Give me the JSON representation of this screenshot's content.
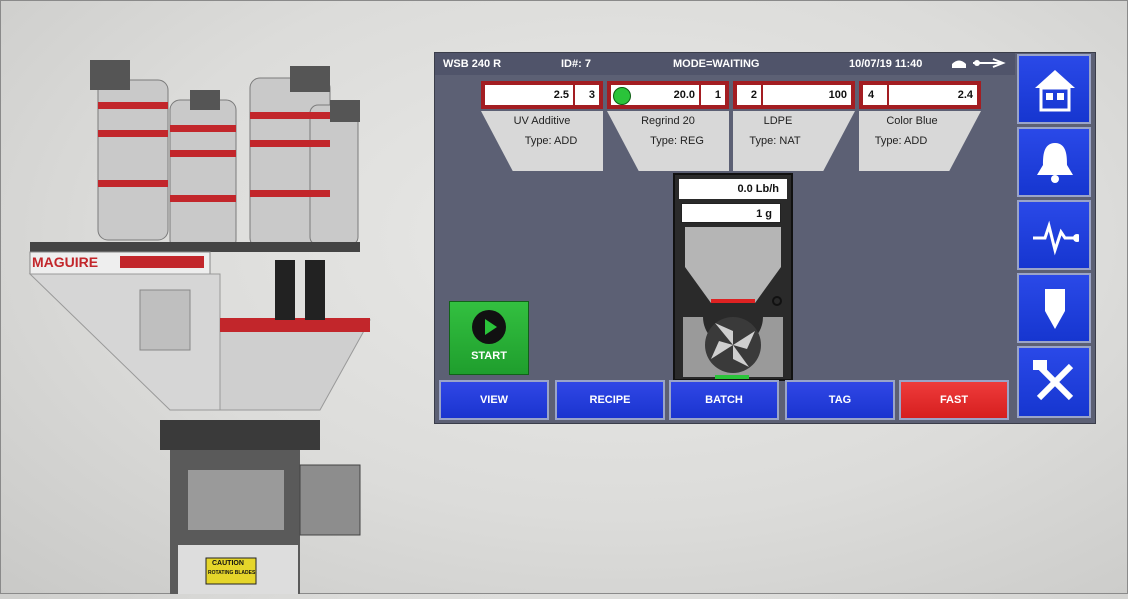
{
  "machine": {
    "brand_label": "MAGUIRE",
    "caution_label": "CAUTION",
    "caution_sub": "ROTATING BLADES"
  },
  "topbar": {
    "model": "WSB  240  R",
    "id": "ID#:  7",
    "mode": "MODE=WAITING",
    "datetime": "10/07/19 11:40"
  },
  "hoppers": [
    {
      "value": "2.5",
      "index": "3",
      "name": "UV Additive",
      "type": "Type: ADD"
    },
    {
      "value": "20.0",
      "index": "1",
      "name": "Regrind 20",
      "type": "Type: REG"
    },
    {
      "index": "2",
      "value": "100",
      "name": "LDPE",
      "type": "Type: NAT"
    },
    {
      "index": "4",
      "value": "2.4",
      "name": "Color Blue",
      "type": "Type: ADD"
    }
  ],
  "readouts": {
    "rate": "0.0 Lb/h",
    "weight": "1 g"
  },
  "start_label": "START",
  "nav": {
    "view": "VIEW",
    "recipe": "RECIPE",
    "batch": "BATCH",
    "tag": "TAG",
    "fast": "FAST"
  },
  "side_icons": [
    "home-icon",
    "bell-icon",
    "pulse-icon",
    "hopper-icon",
    "tools-icon"
  ],
  "colors": {
    "panel": "#5c6074",
    "button_blue": "#1f3ddb",
    "fast_red": "#e02828",
    "start_green": "#2aab36",
    "hopper_red": "#a31d22"
  }
}
